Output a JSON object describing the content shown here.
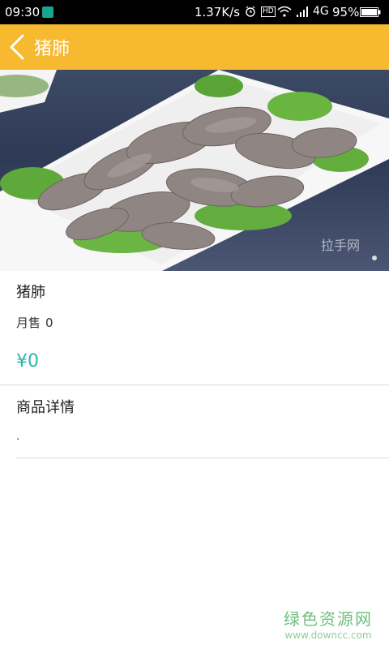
{
  "status_bar": {
    "time": "09:30",
    "net_speed": "1.37K/s",
    "hd_badge": "HD",
    "network_type": "4G",
    "battery_percent": "95%"
  },
  "app_bar": {
    "title": "猪肺",
    "back_icon": "chevron-left-icon",
    "background_color": "#f7b92f"
  },
  "product": {
    "name": "猪肺",
    "monthly_sales_label": "月售",
    "monthly_sales_value": "0",
    "price": "¥0",
    "price_color": "#2bb7a8",
    "image_watermark": "拉手网"
  },
  "details": {
    "title": "商品详情",
    "body": "."
  },
  "watermark": {
    "title": "绿色资源网",
    "url": "www.downcc.com"
  }
}
